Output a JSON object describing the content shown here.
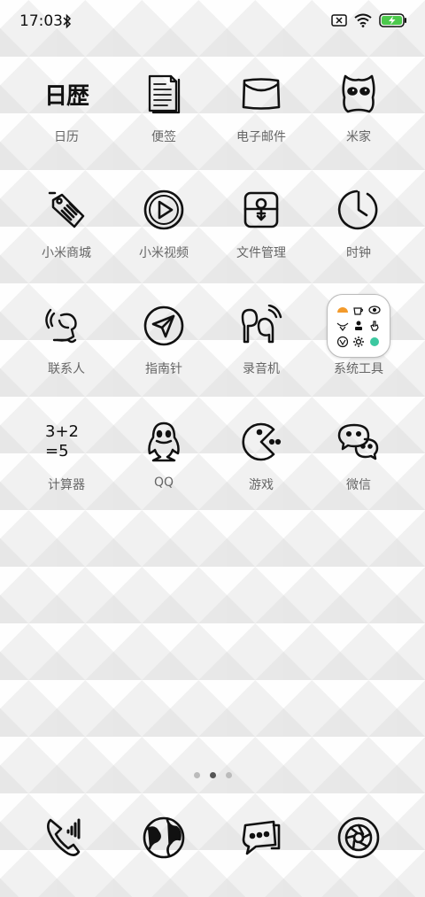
{
  "status_bar": {
    "time": "17:03"
  },
  "apps": [
    {
      "label": "日历",
      "icon": "calendar-icon"
    },
    {
      "label": "便签",
      "icon": "notes-icon"
    },
    {
      "label": "电子邮件",
      "icon": "email-icon"
    },
    {
      "label": "米家",
      "icon": "mijia-icon"
    },
    {
      "label": "小米商城",
      "icon": "tag-icon"
    },
    {
      "label": "小米视频",
      "icon": "play-icon"
    },
    {
      "label": "文件管理",
      "icon": "file-manager-icon"
    },
    {
      "label": "时钟",
      "icon": "clock-icon"
    },
    {
      "label": "联系人",
      "icon": "contacts-icon"
    },
    {
      "label": "指南针",
      "icon": "compass-icon"
    },
    {
      "label": "录音机",
      "icon": "recorder-icon"
    },
    {
      "label": "系统工具",
      "icon": "folder-icon"
    },
    {
      "label": "计算器",
      "icon": "calculator-icon"
    },
    {
      "label": "QQ",
      "icon": "qq-icon"
    },
    {
      "label": "游戏",
      "icon": "game-icon"
    },
    {
      "label": "微信",
      "icon": "wechat-icon"
    }
  ],
  "icon_text": {
    "calendar": "日歴",
    "calc_top": "3+2",
    "calc_bottom": "=5"
  },
  "pager": {
    "pages": 3,
    "current": 2
  },
  "dock": [
    "phone-icon",
    "browser-icon",
    "messages-icon",
    "camera-icon"
  ],
  "colors": {
    "accent_battery": "#4cc94c",
    "folder_orange": "#f39a2b",
    "folder_teal": "#3cc8a0"
  }
}
